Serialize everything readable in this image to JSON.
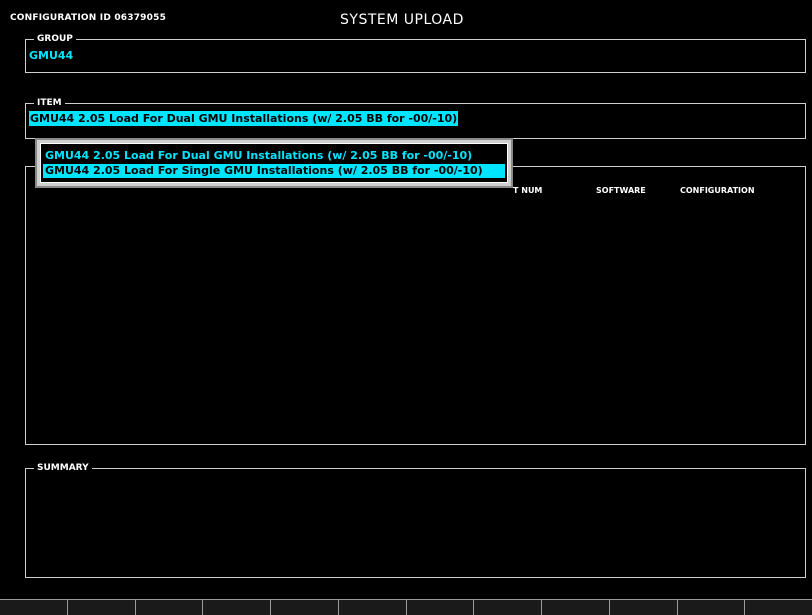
{
  "header": {
    "config_id": "CONFIGURATION ID 06379055",
    "title": "SYSTEM UPLOAD"
  },
  "group": {
    "label": "GROUP",
    "value": "GMU44"
  },
  "item": {
    "label": "ITEM",
    "value": "GMU44 2.05 Load For Dual GMU Installations (w/ 2.05 BB for -00/-10)"
  },
  "dropdown": {
    "options": [
      "GMU44 2.05 Load For Dual GMU Installations (w/ 2.05 BB for -00/-10)",
      "GMU44 2.05 Load For Single GMU Installations (w/ 2.05 BB for -00/-10)"
    ],
    "selected_index": 1
  },
  "list": {
    "columns": {
      "part_num": "T NUM",
      "software": "SOFTWARE",
      "configuration": "CONFIGURATION"
    }
  },
  "summary": {
    "label": "SUMMARY"
  },
  "softkeys": [
    "",
    "",
    "",
    "",
    "",
    "",
    "",
    "",
    "",
    "",
    "",
    ""
  ],
  "colors": {
    "background": "#000000",
    "highlight": "#00e5ff",
    "border": "#cfcfcf"
  }
}
